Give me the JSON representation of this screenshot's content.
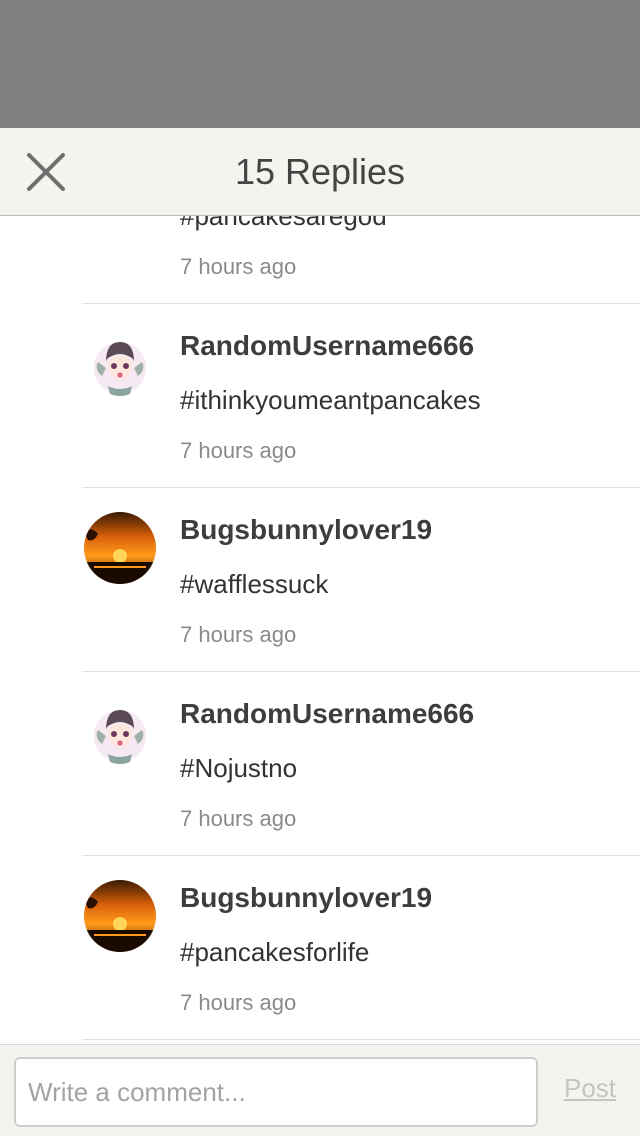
{
  "header": {
    "title": "15 Replies",
    "close_icon": "close-icon"
  },
  "replies": [
    {
      "username": "",
      "message": "#pancakesaregod",
      "time": "7 hours ago",
      "avatar": "sunset-avatar"
    },
    {
      "username": "RandomUsername666",
      "message": "#ithinkyoumeantpancakes",
      "time": "7 hours ago",
      "avatar": "anime-girl-avatar"
    },
    {
      "username": "Bugsbunnylover19",
      "message": "#wafflessuck",
      "time": "7 hours ago",
      "avatar": "sunset-avatar"
    },
    {
      "username": "RandomUsername666",
      "message": "#Nojustno",
      "time": "7 hours ago",
      "avatar": "anime-girl-avatar"
    },
    {
      "username": "Bugsbunnylover19",
      "message": "#pancakesforlife",
      "time": "7 hours ago",
      "avatar": "sunset-avatar"
    }
  ],
  "composer": {
    "placeholder": "Write a comment...",
    "post_label": "Post"
  },
  "colors": {
    "header_bg": "#f5f3ee",
    "overlay": "#808080",
    "username": "#3d3d3d",
    "timestamp": "#8a8a8a",
    "post_disabled": "#c4c4c4"
  }
}
